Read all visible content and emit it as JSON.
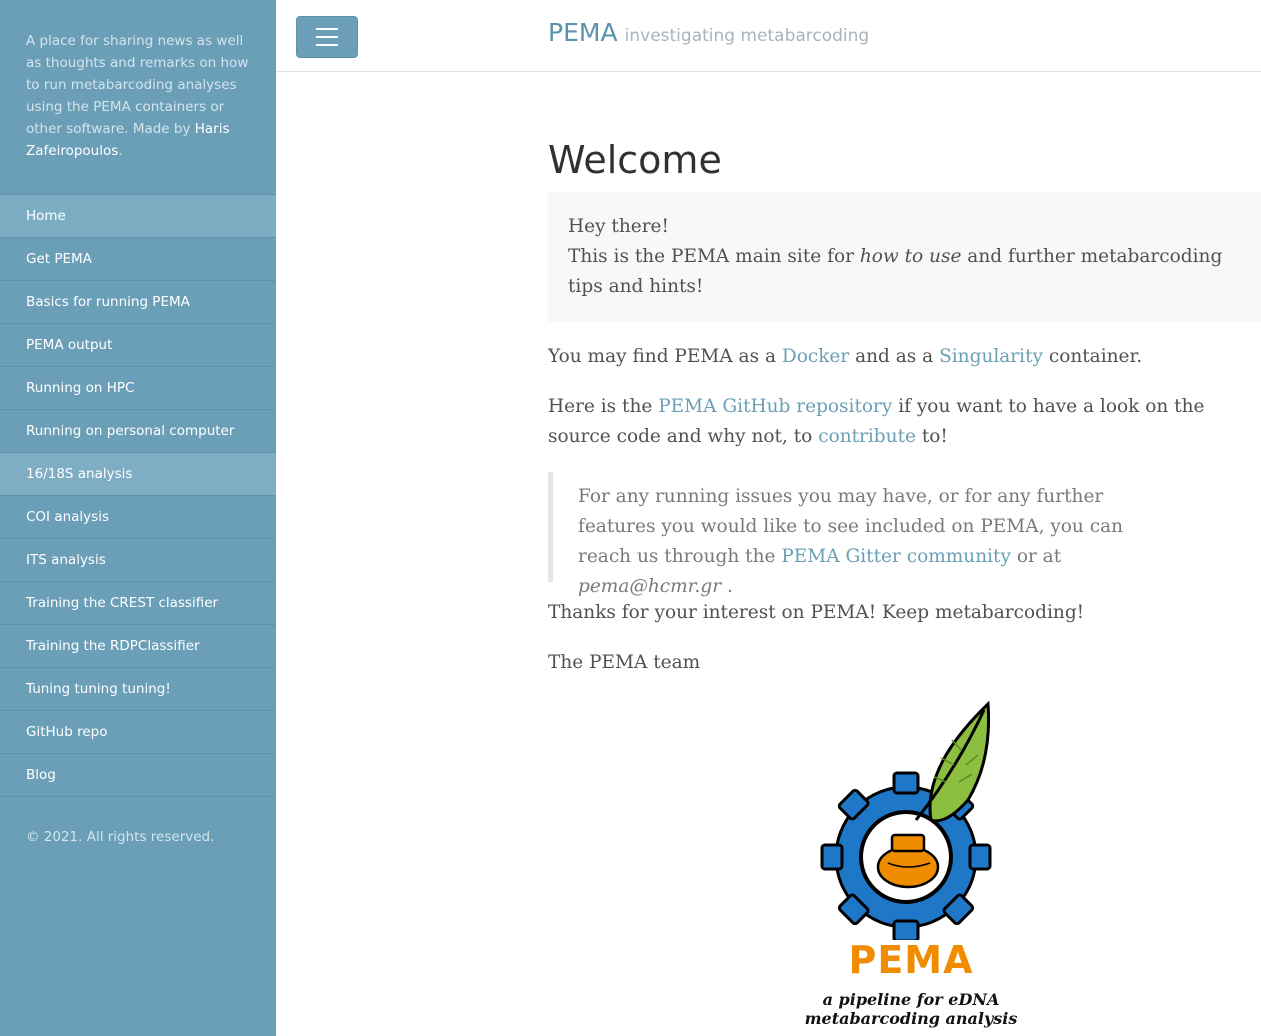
{
  "sidebar": {
    "intro_text": "A place for sharing news as well as thoughts and remarks on how to run metabarcoding analyses using the PEMA containers or other software. Made by ",
    "author_link": "Haris Zafeiropoulos",
    "intro_end": ".",
    "items": [
      {
        "label": "Home"
      },
      {
        "label": "Get PEMA"
      },
      {
        "label": "Basics for running PEMA"
      },
      {
        "label": "PEMA output"
      },
      {
        "label": "Running on HPC"
      },
      {
        "label": "Running on personal computer"
      },
      {
        "label": "16/18S analysis"
      },
      {
        "label": "COI analysis"
      },
      {
        "label": "ITS analysis"
      },
      {
        "label": "Training the CREST classifier"
      },
      {
        "label": "Training the RDPClassifier"
      },
      {
        "label": "Tuning tuning tuning!"
      },
      {
        "label": "GitHub repo"
      },
      {
        "label": "Blog"
      }
    ],
    "footer": "© 2021. All rights reserved."
  },
  "header": {
    "title": "PEMA",
    "subtitle": "investigating metabarcoding",
    "menu_icon": "hamburger-icon"
  },
  "main": {
    "heading": "Welcome",
    "intro": {
      "line1": "Hey there!",
      "line2_a": "This is the PEMA main site for ",
      "line2_em": "how to use",
      "line2_b": " and further metabarcoding tips and hints!"
    },
    "p1": {
      "a": "You may find PEMA as a ",
      "link1": "Docker",
      "b": " and as a ",
      "link2": "Singularity",
      "c": " container."
    },
    "p2": {
      "a": "Here is the ",
      "link1": "PEMA GitHub repository",
      "b": " if you want to have a look on the source code and why not, to ",
      "link2": "contribute",
      "c": " to!"
    },
    "quote": {
      "a": "For any running issues you may have, or for any further features you would like to see included on PEMA, you can reach us through the ",
      "link": "PEMA Gitter community",
      "b": " or at ",
      "em": "pema@hcmr.gr",
      "c": " ."
    },
    "p3": "Thanks for your interest on PEMA! Keep metabarcoding!",
    "p4": "The PEMA team",
    "logo": {
      "name": "PEMA",
      "tagline": "a pipeline for eDNA metabarcoding analysis"
    }
  },
  "colors": {
    "sidebar": "#6b9fb8",
    "link": "#6a9fb5",
    "logo_orange": "#f08c00",
    "logo_blue": "#1f77c8",
    "logo_green": "#8cbf3f"
  }
}
